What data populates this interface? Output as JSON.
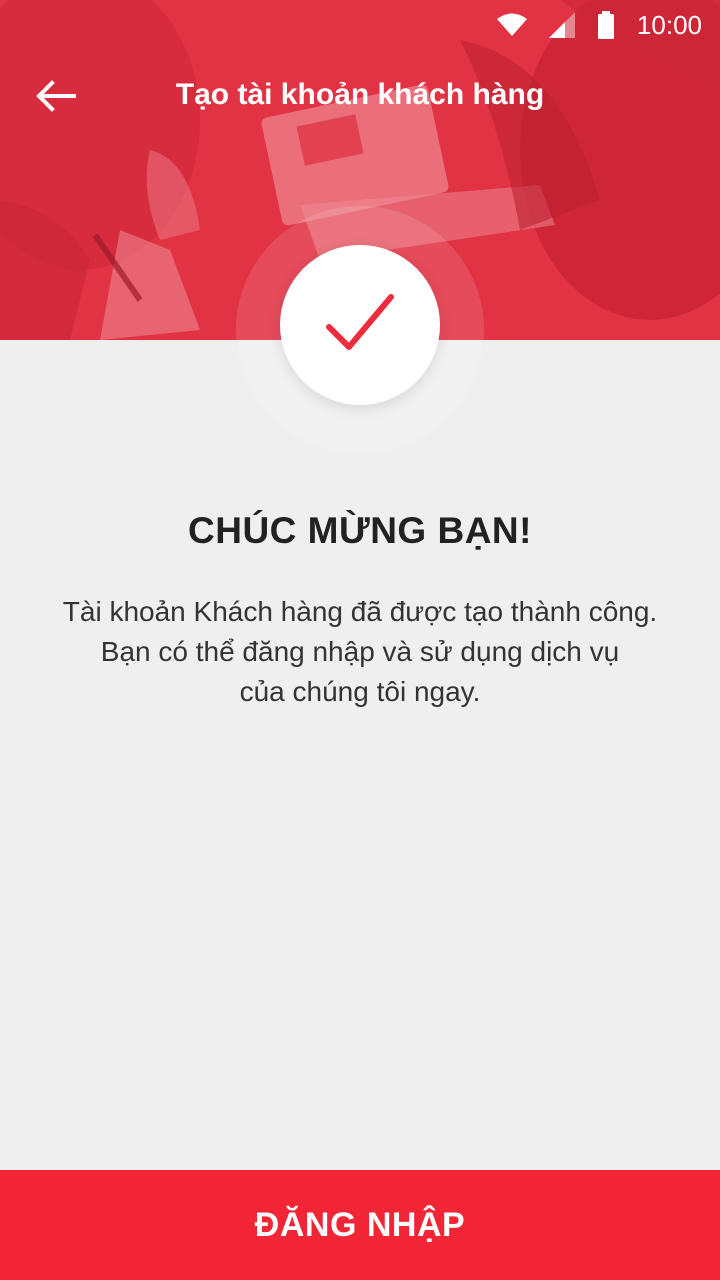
{
  "status_bar": {
    "time": "10:00",
    "icons": [
      "wifi-icon",
      "signal-icon",
      "battery-icon"
    ]
  },
  "app_bar": {
    "back_icon": "arrow-left-icon",
    "title": "Tạo tài khoản khách hàng"
  },
  "success": {
    "icon": "checkmark-icon",
    "headline": "CHÚC MỪNG BẠN!",
    "message_lines": [
      "Tài khoản Khách hàng đã được tạo thành công.",
      "Bạn có thể đăng nhập và sử dụng dịch vụ",
      "của chúng tôi ngay."
    ]
  },
  "actions": {
    "login_label": "ĐĂNG NHẬP"
  },
  "colors": {
    "accent": "#f12535",
    "background": "#efefef",
    "hero_tint": "#e2374a",
    "text_dark": "#222222"
  }
}
